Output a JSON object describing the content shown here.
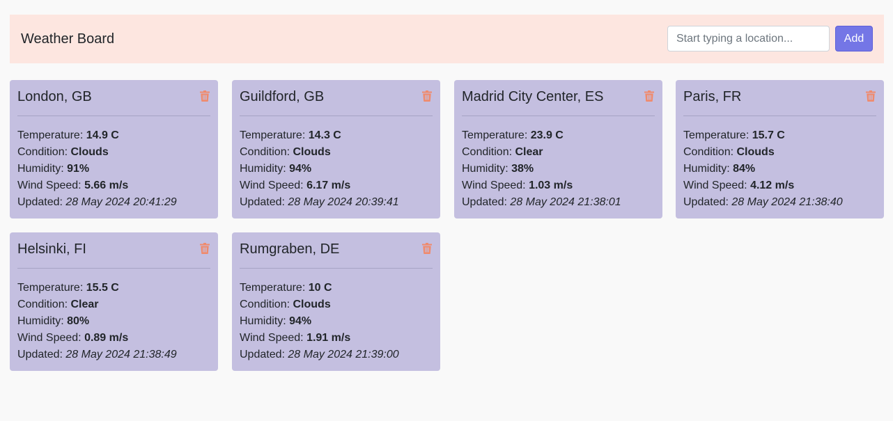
{
  "header": {
    "title": "Weather Board",
    "search_placeholder": "Start typing a location...",
    "add_label": "Add"
  },
  "labels": {
    "temperature": "Temperature: ",
    "condition": "Condition: ",
    "humidity": "Humidity: ",
    "wind": "Wind Speed: ",
    "updated": "Updated: "
  },
  "colors": {
    "header_bg": "#fde6e0",
    "card_bg": "#c4bfe0",
    "button_bg": "#7476e6",
    "trash": "#f08a6c"
  },
  "cards": [
    {
      "location": "London, GB",
      "temperature": "14.9 C",
      "condition": "Clouds",
      "humidity": "91%",
      "wind": "5.66 m/s",
      "updated": "28 May 2024 20:41:29"
    },
    {
      "location": "Guildford, GB",
      "temperature": "14.3 C",
      "condition": "Clouds",
      "humidity": "94%",
      "wind": "6.17 m/s",
      "updated": "28 May 2024 20:39:41"
    },
    {
      "location": "Madrid City Center, ES",
      "temperature": "23.9 C",
      "condition": "Clear",
      "humidity": "38%",
      "wind": "1.03 m/s",
      "updated": "28 May 2024 21:38:01"
    },
    {
      "location": "Paris, FR",
      "temperature": "15.7 C",
      "condition": "Clouds",
      "humidity": "84%",
      "wind": "4.12 m/s",
      "updated": "28 May 2024 21:38:40"
    },
    {
      "location": "Helsinki, FI",
      "temperature": "15.5 C",
      "condition": "Clear",
      "humidity": "80%",
      "wind": "0.89 m/s",
      "updated": "28 May 2024 21:38:49"
    },
    {
      "location": "Rumgraben, DE",
      "temperature": "10 C",
      "condition": "Clouds",
      "humidity": "94%",
      "wind": "1.91 m/s",
      "updated": "28 May 2024 21:39:00"
    }
  ]
}
